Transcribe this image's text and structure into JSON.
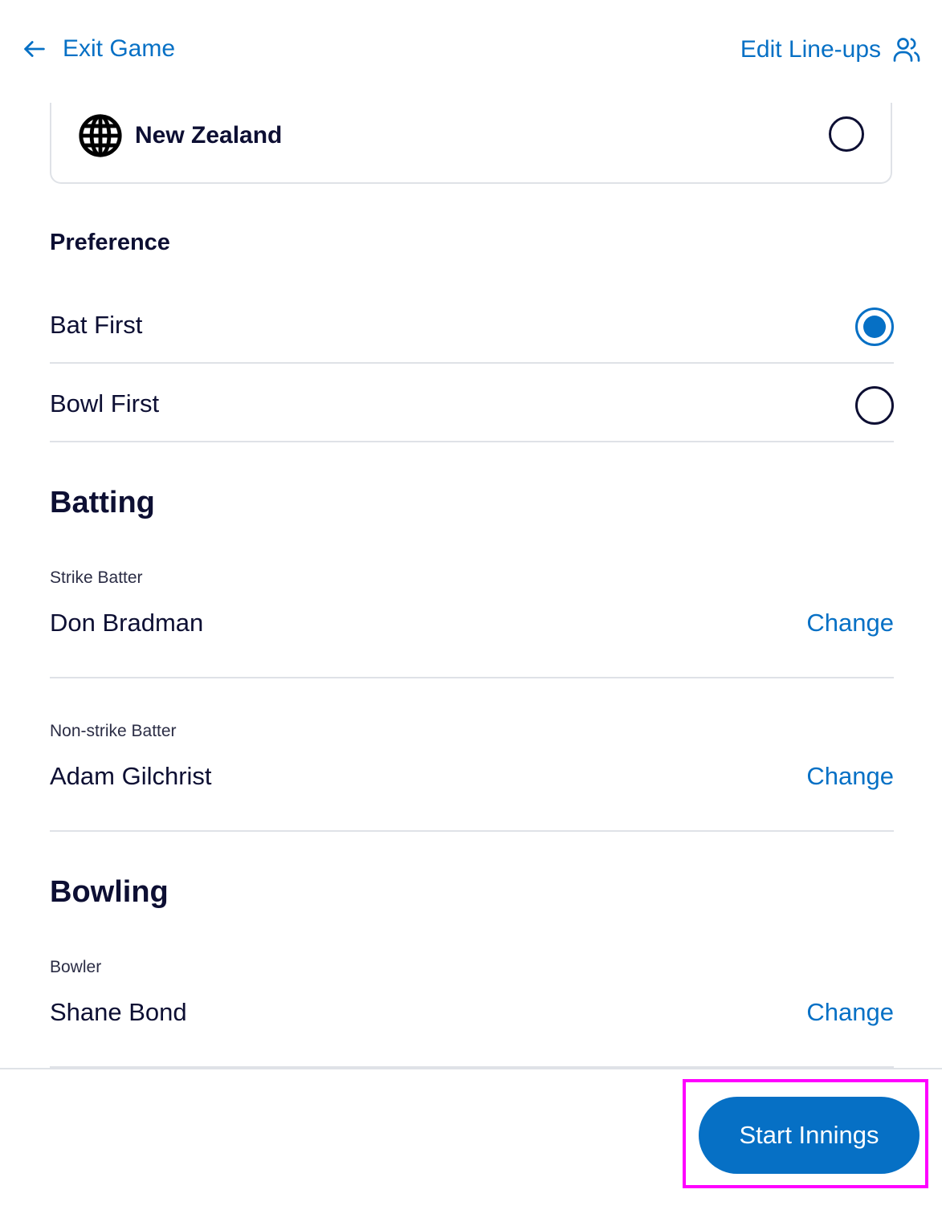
{
  "header": {
    "exit_label": "Exit Game",
    "exit_icon": "arrow-left-icon",
    "edit_label": "Edit Line-ups",
    "edit_icon": "users-icon"
  },
  "team_option": {
    "icon": "globe-icon",
    "name": "New Zealand",
    "selected": false
  },
  "preference": {
    "title": "Preference",
    "options": [
      {
        "label": "Bat First",
        "selected": true
      },
      {
        "label": "Bowl First",
        "selected": false
      }
    ]
  },
  "batting": {
    "title": "Batting",
    "players": [
      {
        "role": "Strike Batter",
        "name": "Don Bradman",
        "action": "Change"
      },
      {
        "role": "Non-strike Batter",
        "name": "Adam Gilchrist",
        "action": "Change"
      }
    ]
  },
  "bowling": {
    "title": "Bowling",
    "players": [
      {
        "role": "Bowler",
        "name": "Shane Bond",
        "action": "Change"
      }
    ]
  },
  "footer": {
    "start_label": "Start Innings"
  },
  "colors": {
    "accent": "#0670c5",
    "text": "#0d0f33",
    "divider": "#dfe2e7",
    "highlight": "#ff00ff"
  }
}
